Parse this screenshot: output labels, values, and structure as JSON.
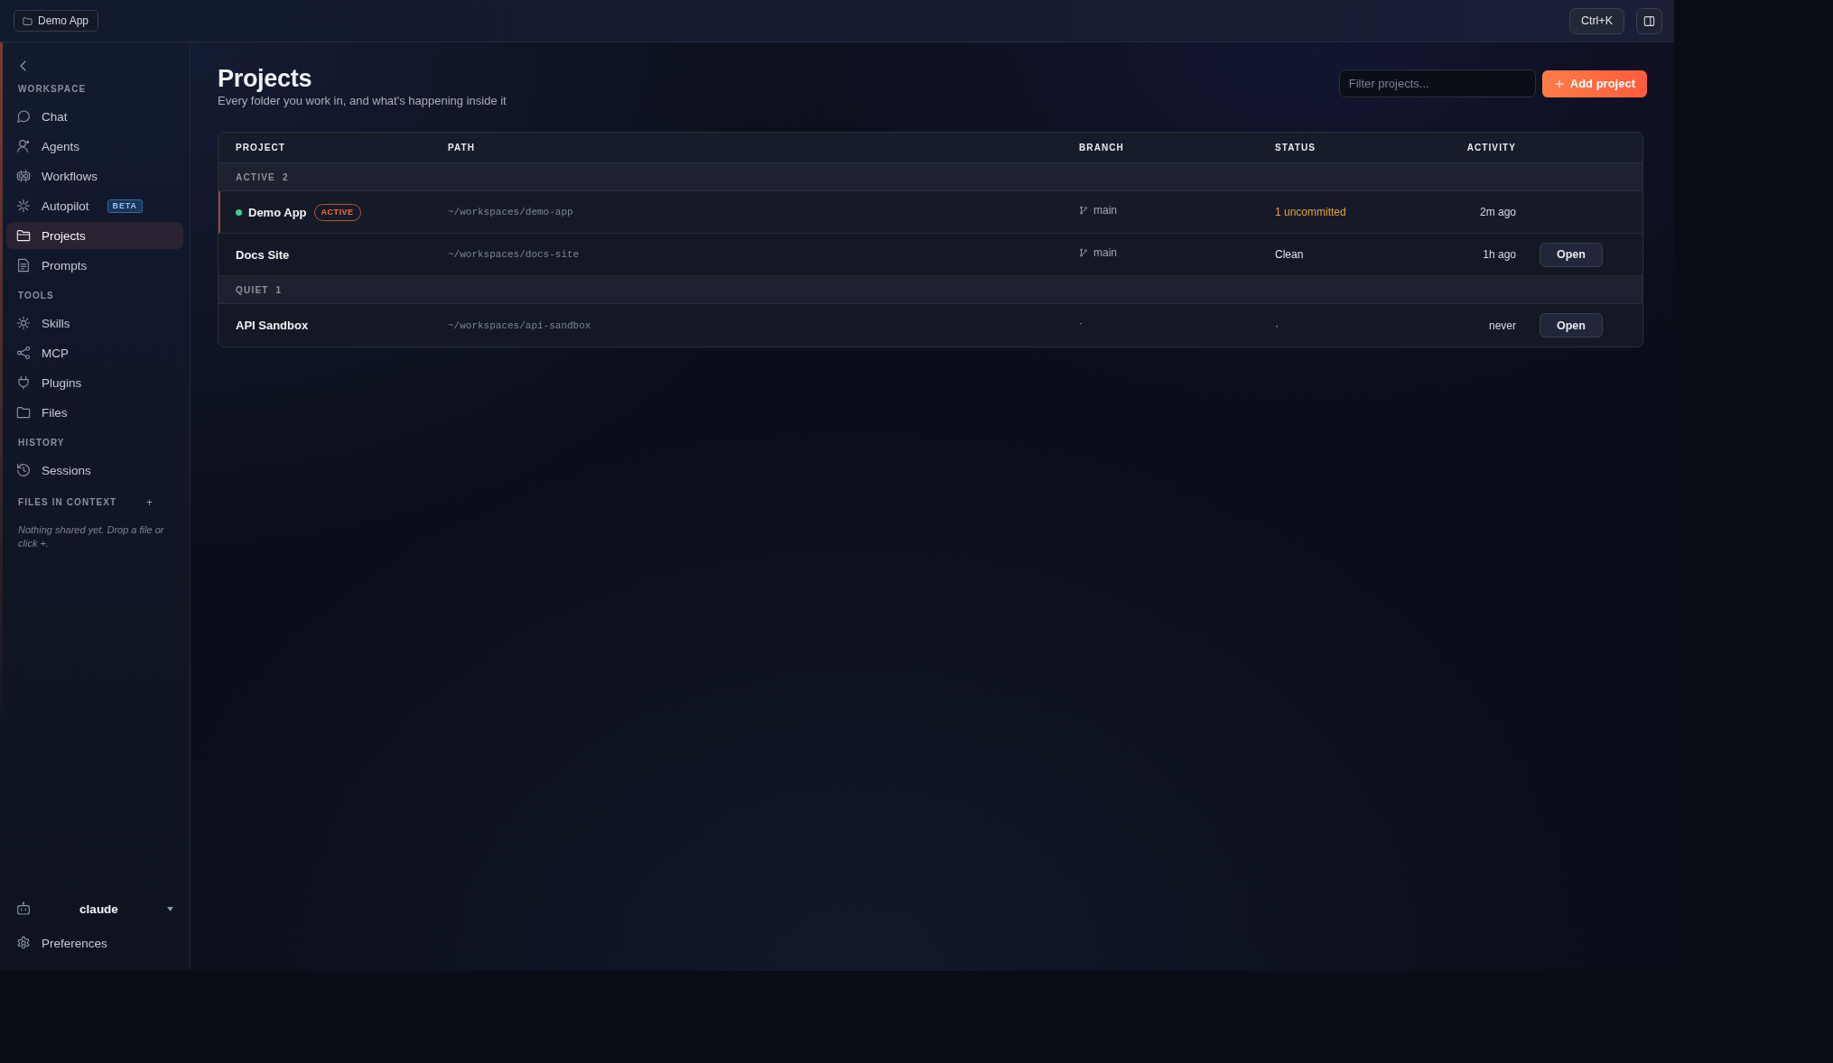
{
  "top_bar": {
    "project_chip": "Demo App",
    "shortcut_button": "Ctrl+K"
  },
  "sidebar": {
    "sections": [
      {
        "title": "WORKSPACE",
        "items": [
          {
            "label": "Chat",
            "selected": false
          },
          {
            "label": "Agents",
            "selected": false
          },
          {
            "label": "Workflows",
            "selected": false
          },
          {
            "label": "Autopilot",
            "selected": false,
            "badge": "BETA"
          },
          {
            "label": "Projects",
            "selected": true
          },
          {
            "label": "Prompts",
            "selected": false
          }
        ]
      },
      {
        "title": "TOOLS",
        "items": [
          {
            "label": "Skills",
            "selected": false
          },
          {
            "label": "MCP",
            "selected": false
          },
          {
            "label": "Plugins",
            "selected": false
          },
          {
            "label": "Files",
            "selected": false
          }
        ]
      },
      {
        "title": "HISTORY",
        "items": [
          {
            "label": "Sessions",
            "selected": false
          }
        ]
      }
    ],
    "files_in_context": {
      "title": "FILES IN CONTEXT",
      "add_button": "+",
      "note": "Nothing shared yet. Drop a file or click +."
    },
    "agent_selector": {
      "name": "claude"
    },
    "preferences": "Preferences"
  },
  "page": {
    "title": "Projects",
    "subtitle": "Every folder you work in, and what's happening inside it",
    "filter": {
      "placeholder": "Filter projects..."
    },
    "add_button": "Add project"
  },
  "table": {
    "columns": [
      "PROJECT",
      "PATH",
      "BRANCH",
      "STATUS",
      "ACTIVITY"
    ],
    "groups": [
      {
        "label": "ACTIVE",
        "count": "2",
        "rows": [
          {
            "name": "Demo App",
            "current": true,
            "badge": "ACTIVE",
            "path": "~/workspaces/demo-app",
            "branch": "main",
            "has_branch": true,
            "status": {
              "text": "1 uncommitted",
              "color": "#e3a43a"
            },
            "activity": "2m ago"
          },
          {
            "name": "Docs Site",
            "current": false,
            "path": "~/workspaces/docs-site",
            "branch": "main",
            "has_branch": true,
            "status": {
              "text": "Clean",
              "color": "#e3e5ea"
            },
            "activity": "1h ago",
            "action": "Open"
          }
        ]
      },
      {
        "label": "QUIET",
        "count": "1",
        "rows": [
          {
            "name": "API Sandbox",
            "current": false,
            "path": "~/workspaces/api-sandbox",
            "branch": "·",
            "has_branch": false,
            "status": {
              "text": "·"
            },
            "activity": "never",
            "action": "Open"
          }
        ]
      }
    ]
  }
}
